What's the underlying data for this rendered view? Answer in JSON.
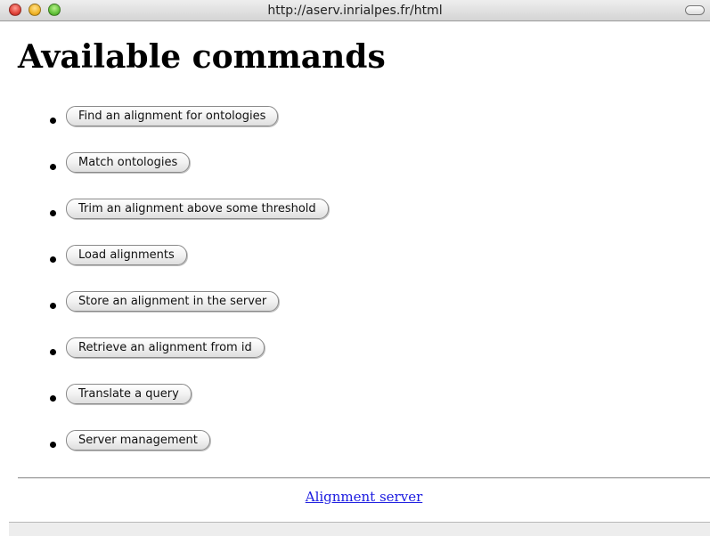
{
  "window": {
    "url": "http://aserv.inrialpes.fr/html"
  },
  "page": {
    "heading": "Available commands",
    "commands": [
      "Find an alignment for ontologies",
      "Match ontologies",
      "Trim an alignment above some threshold",
      "Load alignments",
      "Store an alignment in the server",
      "Retrieve an alignment from id",
      "Translate a query",
      "Server management"
    ],
    "footer_link": "Alignment server"
  },
  "colors": {
    "link": "#1a1ae0",
    "button_border": "#8a8a8a"
  },
  "icons": [
    "close-icon",
    "minimize-icon",
    "zoom-icon",
    "toolbar-toggle-icon"
  ]
}
